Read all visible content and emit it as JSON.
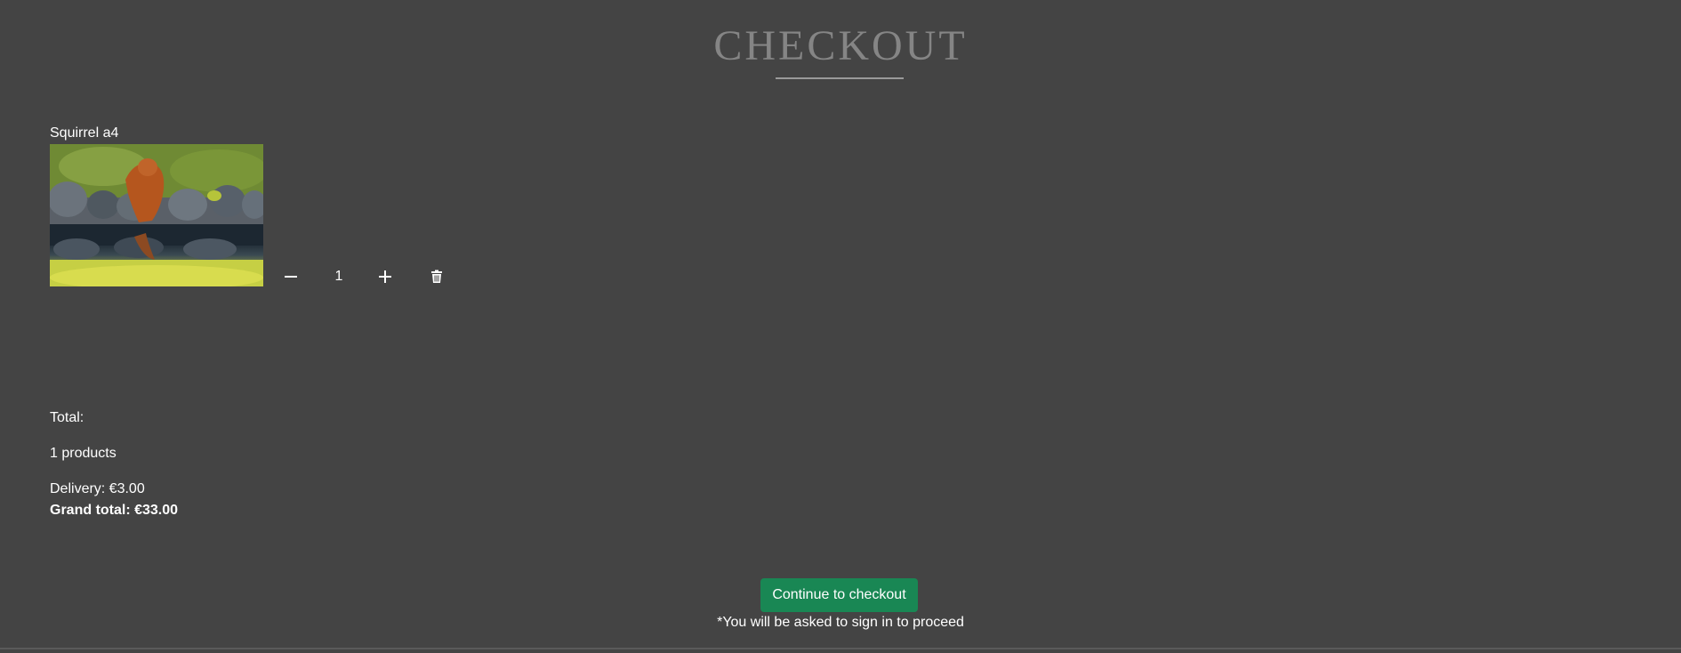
{
  "header": {
    "title": "CHECKOUT"
  },
  "cart": {
    "items": [
      {
        "name": "Squirrel a4",
        "image_alt": "Red squirrel drinking from pond among rocks",
        "quantity": "1"
      }
    ]
  },
  "summary": {
    "total_label": "Total:",
    "products_count": "1 products",
    "delivery": "Delivery: €3.00",
    "grand_total": "Grand total: €33.00"
  },
  "actions": {
    "checkout_button": "Continue to checkout",
    "signin_note": "*You will be asked to sign in to proceed"
  },
  "icons": {
    "decrease": "minus-icon",
    "increase": "plus-icon",
    "remove": "trash-icon"
  },
  "colors": {
    "background": "#444444",
    "checkout_button": "#198754",
    "title": "#858585"
  }
}
